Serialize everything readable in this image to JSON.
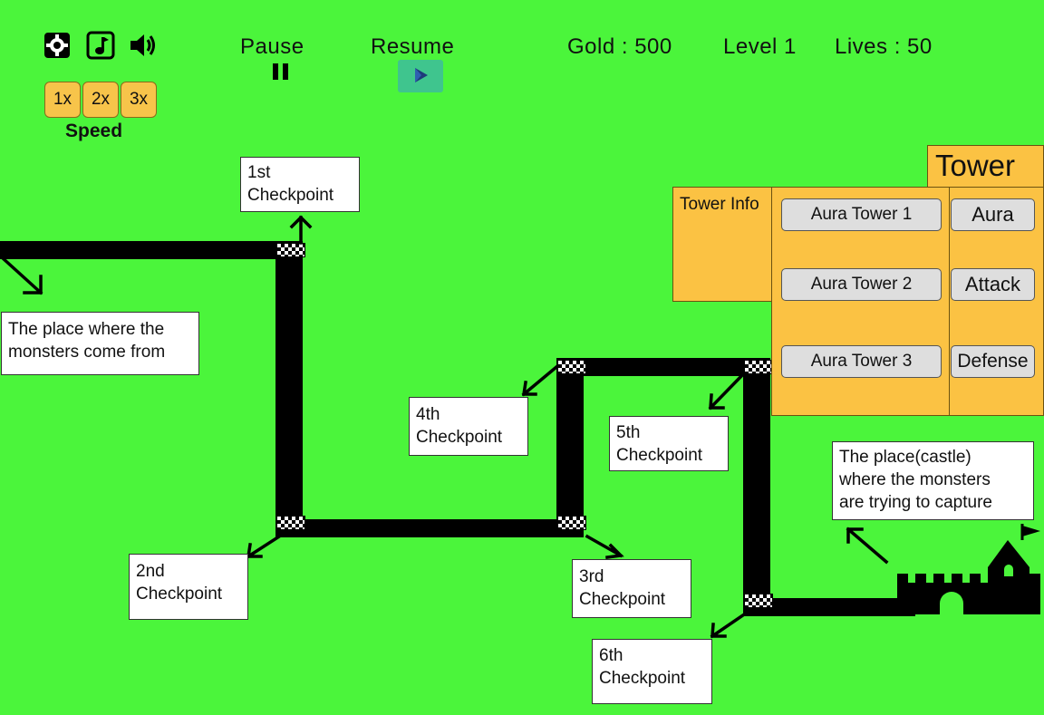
{
  "hud": {
    "settings_icon": "gear-icon",
    "music_icon": "music-note-icon",
    "sound_icon": "speaker-icon",
    "pause_label": "Pause",
    "resume_label": "Resume",
    "gold": "Gold : 500",
    "level": "Level 1",
    "lives": "Lives : 50"
  },
  "speed": {
    "label": "Speed",
    "options": [
      "1x",
      "2x",
      "3x"
    ]
  },
  "tower_panel": {
    "title": "Tower",
    "info_label": "Tower Info",
    "towers": [
      "Aura Tower 1",
      "Aura Tower 2",
      "Aura Tower 3"
    ],
    "categories": [
      "Aura",
      "Attack",
      "Defense"
    ]
  },
  "callouts": {
    "spawn": "The place where the\nmonsters come from",
    "castle": "The place(castle)\nwhere the monsters\nare trying to capture",
    "cp1": "1st\nCheckpoint",
    "cp2": "2nd\nCheckpoint",
    "cp3": "3rd\nCheckpoint",
    "cp4": "4th\nCheckpoint",
    "cp5": "5th\nCheckpoint",
    "cp6": "6th\nCheckpoint"
  },
  "colors": {
    "background": "#4bf53b",
    "panel": "#fbc243",
    "resume_button": "#3fc58e",
    "path": "#000000"
  }
}
